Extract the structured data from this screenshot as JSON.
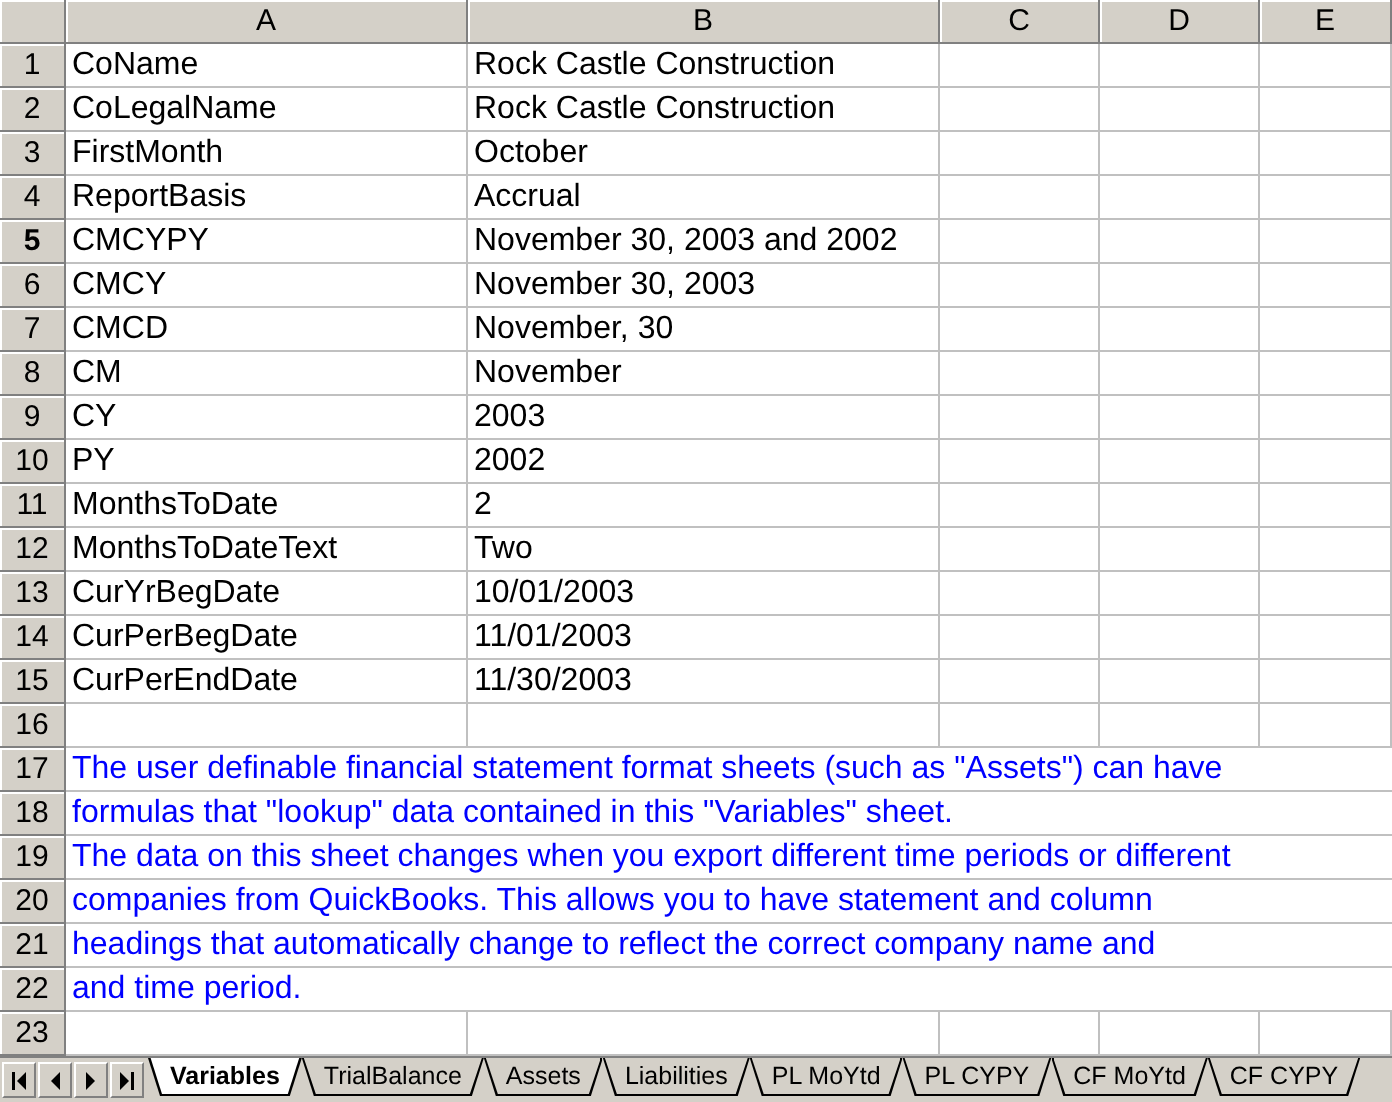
{
  "columns": [
    "A",
    "B",
    "C",
    "D",
    "E"
  ],
  "rows": [
    {
      "number": "1",
      "selected": false,
      "kind": "data",
      "cells": [
        "CoName",
        "Rock Castle Construction"
      ]
    },
    {
      "number": "2",
      "selected": false,
      "kind": "data",
      "cells": [
        "CoLegalName",
        "Rock Castle Construction"
      ]
    },
    {
      "number": "3",
      "selected": false,
      "kind": "data",
      "cells": [
        "FirstMonth",
        "October"
      ]
    },
    {
      "number": "4",
      "selected": false,
      "kind": "data",
      "cells": [
        "ReportBasis",
        "Accrual"
      ]
    },
    {
      "number": "5",
      "selected": true,
      "kind": "data",
      "cells": [
        "CMCYPY",
        "November 30, 2003 and 2002"
      ]
    },
    {
      "number": "6",
      "selected": false,
      "kind": "data",
      "cells": [
        "CMCY",
        "November 30, 2003"
      ]
    },
    {
      "number": "7",
      "selected": false,
      "kind": "data",
      "cells": [
        "CMCD",
        "November, 30"
      ]
    },
    {
      "number": "8",
      "selected": false,
      "kind": "data",
      "cells": [
        "CM",
        "November"
      ]
    },
    {
      "number": "9",
      "selected": false,
      "kind": "data",
      "cells": [
        "CY",
        "2003"
      ]
    },
    {
      "number": "10",
      "selected": false,
      "kind": "data",
      "cells": [
        "PY",
        "2002"
      ]
    },
    {
      "number": "11",
      "selected": false,
      "kind": "data",
      "cells": [
        "MonthsToDate",
        "2"
      ]
    },
    {
      "number": "12",
      "selected": false,
      "kind": "data",
      "cells": [
        "MonthsToDateText",
        "Two"
      ]
    },
    {
      "number": "13",
      "selected": false,
      "kind": "data",
      "cells": [
        "CurYrBegDate",
        "10/01/2003"
      ]
    },
    {
      "number": "14",
      "selected": false,
      "kind": "data",
      "cells": [
        "CurPerBegDate",
        "11/01/2003"
      ]
    },
    {
      "number": "15",
      "selected": false,
      "kind": "data",
      "cells": [
        "CurPerEndDate",
        "11/30/2003"
      ]
    },
    {
      "number": "16",
      "selected": false,
      "kind": "data",
      "cells": []
    },
    {
      "number": "17",
      "selected": false,
      "kind": "note",
      "text": "The user definable financial statement format sheets (such as \"Assets\") can have"
    },
    {
      "number": "18",
      "selected": false,
      "kind": "note",
      "text": "formulas that \"lookup\" data contained in this \"Variables\" sheet."
    },
    {
      "number": "19",
      "selected": false,
      "kind": "note",
      "text": "The data on this sheet changes when you export different time periods or different"
    },
    {
      "number": "20",
      "selected": false,
      "kind": "note",
      "text": "companies from QuickBooks. This allows you to have statement and column"
    },
    {
      "number": "21",
      "selected": false,
      "kind": "note",
      "text": "headings that automatically change to reflect the correct company name and"
    },
    {
      "number": "22",
      "selected": false,
      "kind": "note",
      "text": "and time period."
    },
    {
      "number": "23",
      "selected": false,
      "kind": "data",
      "cells": []
    }
  ],
  "sheet_tabs": [
    {
      "label": "Variables",
      "selected": true
    },
    {
      "label": "TrialBalance",
      "selected": false
    },
    {
      "label": "Assets",
      "selected": false
    },
    {
      "label": "Liabilities",
      "selected": false
    },
    {
      "label": "PL MoYtd",
      "selected": false
    },
    {
      "label": "PL CYPY",
      "selected": false
    },
    {
      "label": "CF MoYtd",
      "selected": false
    },
    {
      "label": "CF CYPY",
      "selected": false
    }
  ]
}
